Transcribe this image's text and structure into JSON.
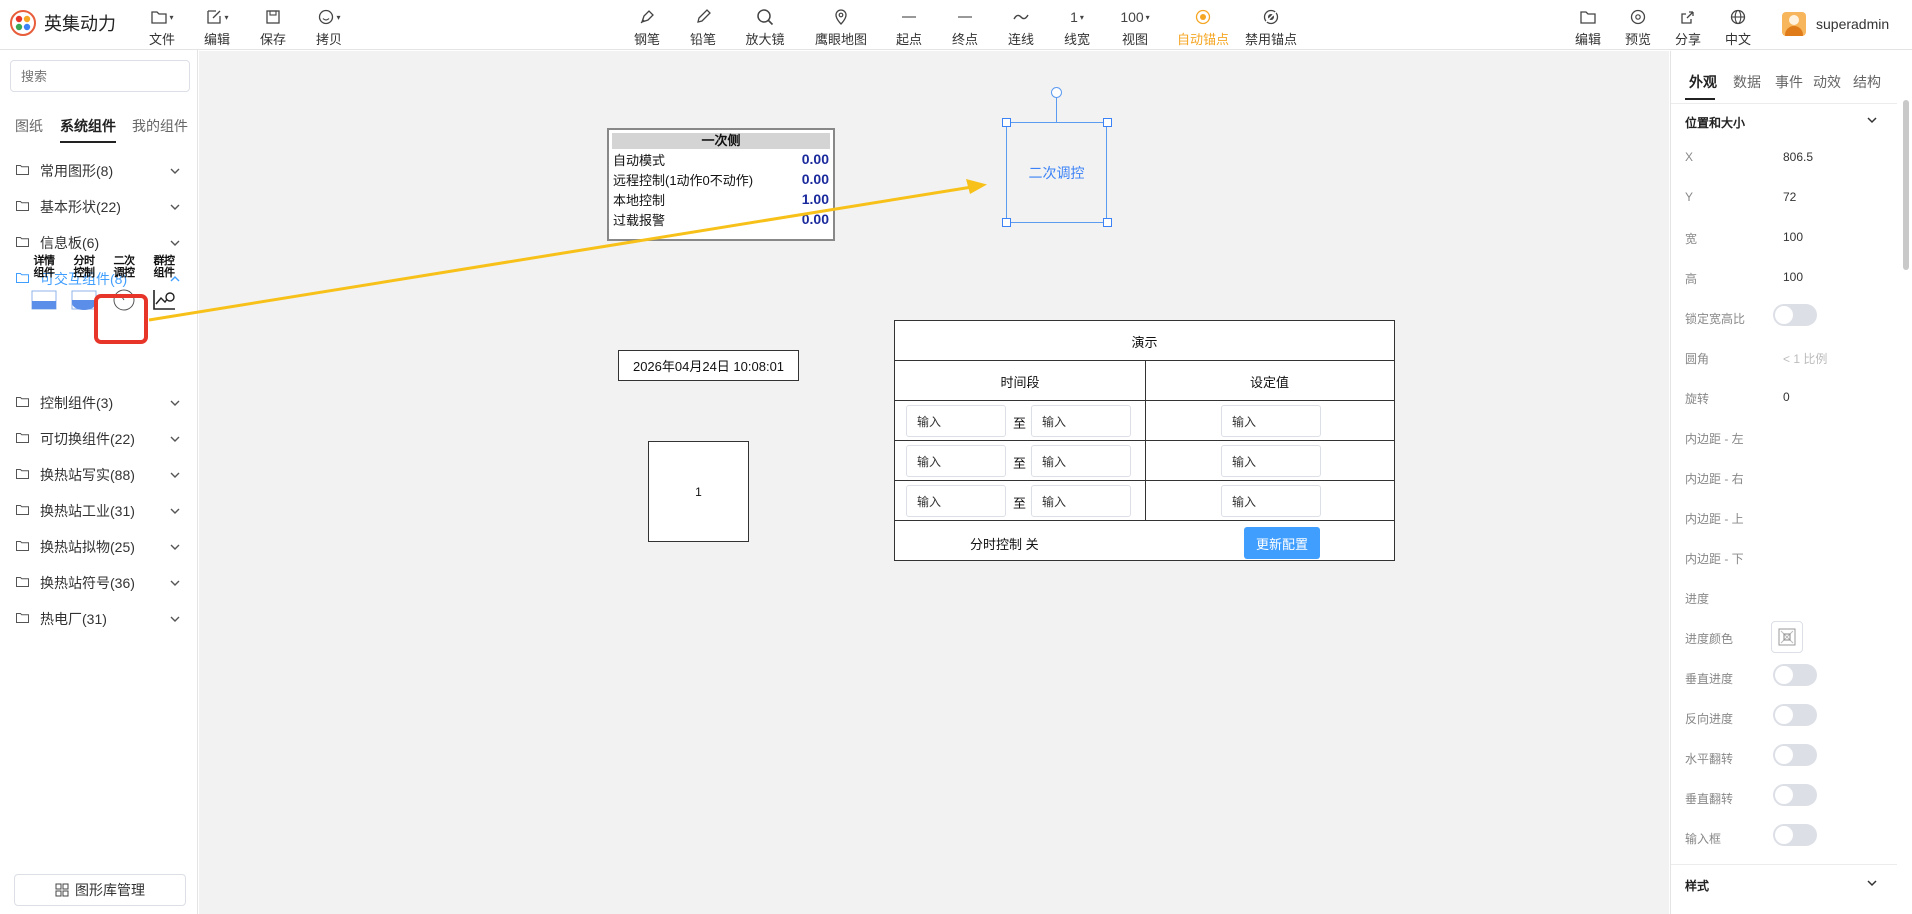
{
  "app": {
    "title": "英集动力"
  },
  "toolbar": {
    "left": [
      {
        "label": "文件",
        "icon": "file-icon"
      },
      {
        "label": "编辑",
        "icon": "edit-icon"
      },
      {
        "label": "保存",
        "icon": "save-icon"
      },
      {
        "label": "拷贝",
        "icon": "smile-icon"
      }
    ],
    "center": [
      {
        "label": "钢笔",
        "icon": "pen-icon"
      },
      {
        "label": "铅笔",
        "icon": "pencil-icon"
      },
      {
        "label": "放大镜",
        "icon": "magnifier-icon"
      },
      {
        "label": "鹰眼地图",
        "icon": "location-icon"
      },
      {
        "label": "起点",
        "icon": "line-start-icon"
      },
      {
        "label": "终点",
        "icon": "line-end-icon"
      },
      {
        "label": "连线",
        "icon": "curve-icon"
      },
      {
        "label": "线宽",
        "value": "1"
      },
      {
        "label": "视图",
        "value": "100"
      },
      {
        "label": "自动锚点",
        "icon": "anchor-auto-icon",
        "active": true
      },
      {
        "label": "禁用锚点",
        "icon": "anchor-disable-icon"
      }
    ],
    "right": [
      {
        "label": "编辑",
        "icon": "folder-edit-icon"
      },
      {
        "label": "预览",
        "icon": "eye-icon"
      },
      {
        "label": "分享",
        "icon": "share-icon"
      },
      {
        "label": "中文",
        "icon": "globe-icon"
      }
    ],
    "user": "superadmin"
  },
  "left": {
    "search_placeholder": "搜索",
    "tabs": [
      "图纸",
      "系统组件",
      "我的组件"
    ],
    "categories": [
      "常用图形(8)",
      "基本形状(22)",
      "信息板(6)",
      "可交互组件(8)",
      "控制组件(3)",
      "可切换组件(22)",
      "换热站写实(88)",
      "换热站工业(31)",
      "换热站拟物(25)",
      "换热站符号(36)",
      "热电厂(31)"
    ],
    "components": [
      {
        "line1": "详情",
        "line2": "组件"
      },
      {
        "line1": "分时",
        "line2": "控制"
      },
      {
        "line1": "二次",
        "line2": "调控"
      },
      {
        "line1": "群控",
        "line2": "组件"
      }
    ],
    "library_button": "图形库管理"
  },
  "canvas": {
    "panel": {
      "title": "一次侧",
      "rows": [
        {
          "label": "自动模式",
          "value": "0.00"
        },
        {
          "label": "远程控制(1动作0不动作)",
          "value": "0.00"
        },
        {
          "label": "本地控制",
          "value": "1.00"
        },
        {
          "label": "过载报警",
          "value": "0.00"
        }
      ]
    },
    "selected_label": "二次调控",
    "datetime": "2026年04月24日 10:08:01",
    "box_number": "1",
    "demo": {
      "title": "演示",
      "col1": "时间段",
      "col2": "设定值",
      "input_placeholder": "输入",
      "to_label": "至",
      "status": "分时控制 关",
      "update_button": "更新配置"
    }
  },
  "right": {
    "tabs": [
      "外观",
      "数据",
      "事件",
      "动效",
      "结构"
    ],
    "section_position": "位置和大小",
    "section_style": "样式",
    "props": {
      "x_label": "X",
      "x_value": "806.5",
      "y_label": "Y",
      "y_value": "72",
      "w_label": "宽",
      "w_value": "100",
      "h_label": "高",
      "h_value": "100",
      "lock_label": "锁定宽高比",
      "radius_label": "圆角",
      "radius_placeholder": "< 1 比例",
      "rotate_label": "旋转",
      "rotate_value": "0",
      "pad_left": "内边距 - 左",
      "pad_right": "内边距 - 右",
      "pad_top": "内边距 - 上",
      "pad_bottom": "内边距 - 下",
      "progress_label": "进度",
      "progress_color_label": "进度颜色",
      "vertical_progress_label": "垂直进度",
      "reverse_progress_label": "反向进度",
      "flip_h_label": "水平翻转",
      "flip_v_label": "垂直翻转",
      "input_label": "输入框"
    }
  },
  "colors": {
    "accent": "#409eff",
    "active_tool": "#f5a623",
    "highlight": "#e8352a",
    "arrow": "#f7c11a"
  }
}
